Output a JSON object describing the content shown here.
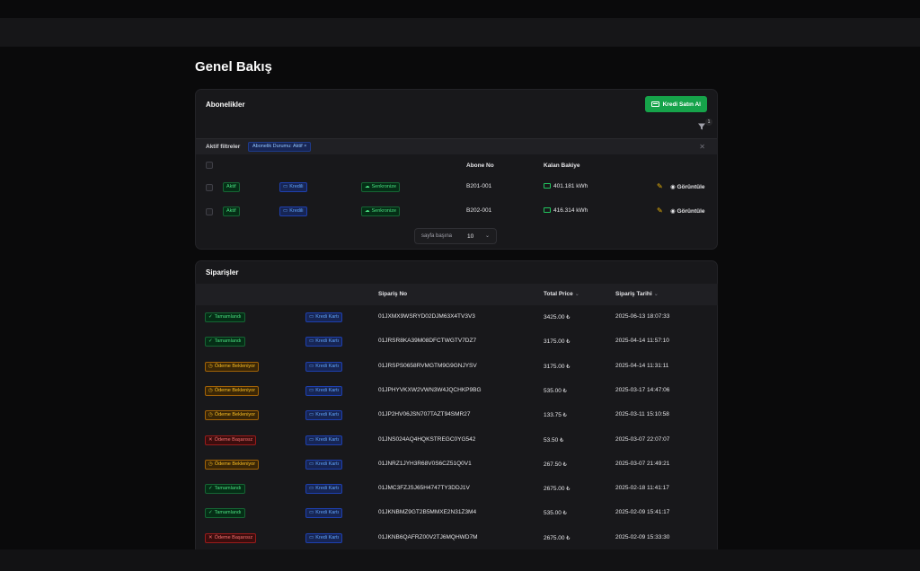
{
  "page": {
    "title": "Genel Bakış"
  },
  "subscriptions": {
    "title": "Abonelikler",
    "buy_button": "Kredi Satın Al",
    "filter_count": "1",
    "active_filters_label": "Aktif filtreler",
    "active_filter_chip": "Abonelik Durumu: Aktif ×",
    "columns": {
      "subscriber_no": "Abone No",
      "remaining_balance": "Kalan Bakiye"
    },
    "rows": [
      {
        "status": "Aktif",
        "type": "Kredili",
        "sync": "Senkronize",
        "subscriber_no": "B201-001",
        "balance": "401.181 kWh",
        "view": "Görüntüle"
      },
      {
        "status": "Aktif",
        "type": "Kredili",
        "sync": "Senkronize",
        "subscriber_no": "B202-001",
        "balance": "416.314 kWh",
        "view": "Görüntüle"
      }
    ],
    "pager": {
      "label": "sayfa başına",
      "value": "10"
    }
  },
  "orders": {
    "title": "Siparişler",
    "columns": {
      "order_no": "Sipariş No",
      "total_price": "Total Price",
      "order_date": "Sipariş Tarihi"
    },
    "rows": [
      {
        "status": "Tamamlandı",
        "kind": "done",
        "payment": "Kredi Kartı",
        "order_no": "01JXMX9WSRYD02DJM63X4TV3V3",
        "price": "3425.00 ₺",
        "date": "2025-06-13 18:07:33"
      },
      {
        "status": "Tamamlandı",
        "kind": "done",
        "payment": "Kredi Kartı",
        "order_no": "01JRSR8KA39M08DFCTWGTV7DZ7",
        "price": "3175.00 ₺",
        "date": "2025-04-14 11:57:10"
      },
      {
        "status": "Ödeme Bekleniyor",
        "kind": "pending",
        "payment": "Kredi Kartı",
        "order_no": "01JRSPS0658RVMGTM9G9GNJYSV",
        "price": "3175.00 ₺",
        "date": "2025-04-14 11:31:11"
      },
      {
        "status": "Ödeme Bekleniyor",
        "kind": "pending",
        "payment": "Kredi Kartı",
        "order_no": "01JPHYVKXW2VWN3W4JQCHKP9BG",
        "price": "535.00 ₺",
        "date": "2025-03-17 14:47:06"
      },
      {
        "status": "Ödeme Bekleniyor",
        "kind": "pending",
        "payment": "Kredi Kartı",
        "order_no": "01JP2HV06JSN707TAZT94SMR27",
        "price": "133.75 ₺",
        "date": "2025-03-11 15:10:58"
      },
      {
        "status": "Ödeme Başarısız",
        "kind": "failed",
        "payment": "Kredi Kartı",
        "order_no": "01JNS024AQ4HQKSTREGC0YG542",
        "price": "53.50 ₺",
        "date": "2025-03-07 22:07:07"
      },
      {
        "status": "Ödeme Bekleniyor",
        "kind": "pending",
        "payment": "Kredi Kartı",
        "order_no": "01JNRZ1JYH3R68V0S6CZ51Q0V1",
        "price": "267.50 ₺",
        "date": "2025-03-07 21:49:21"
      },
      {
        "status": "Tamamlandı",
        "kind": "done",
        "payment": "Kredi Kartı",
        "order_no": "01JMC3FZJSJ65H4747TY3DDJ1V",
        "price": "2675.00 ₺",
        "date": "2025-02-18 11:41:17"
      },
      {
        "status": "Tamamlandı",
        "kind": "done",
        "payment": "Kredi Kartı",
        "order_no": "01JKNBMZ9GT2B5MMXE2N31Z3M4",
        "price": "535.00 ₺",
        "date": "2025-02-09 15:41:17"
      },
      {
        "status": "Ödeme Başarısız",
        "kind": "failed",
        "payment": "Kredi Kartı",
        "order_no": "01JKNB6QAFRZ00V2TJ6MQHWD7M",
        "price": "2675.00 ₺",
        "date": "2025-02-09 15:33:30"
      }
    ]
  }
}
